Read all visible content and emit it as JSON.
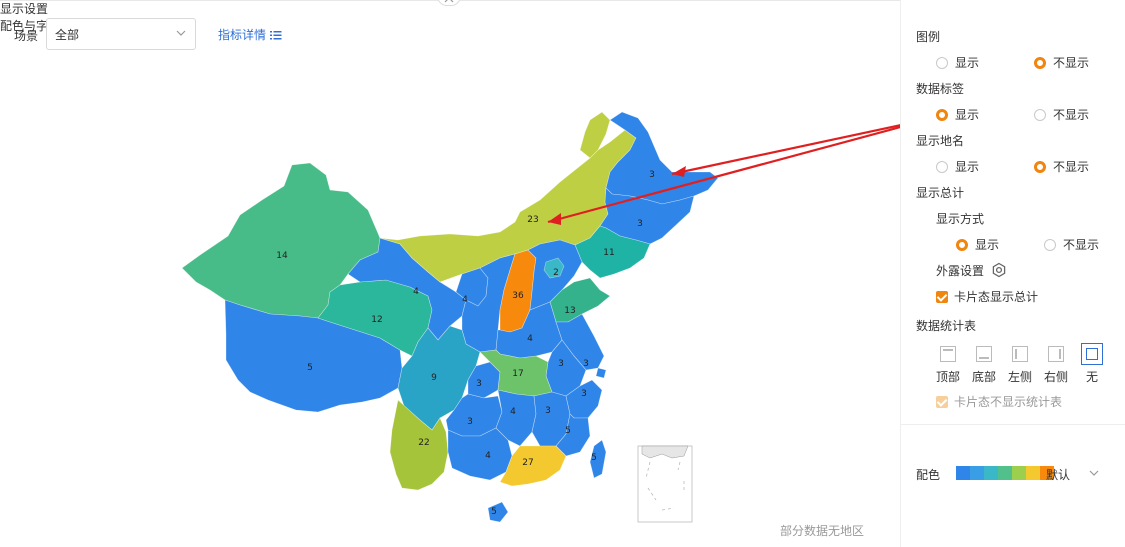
{
  "toolbar": {
    "scene_label": "场景",
    "scene_value": "全部",
    "detail_link": "指标详情"
  },
  "map": {
    "no_data_note": "部分数据无地区",
    "region_values": [
      "14",
      "12",
      "5",
      "9",
      "22",
      "3",
      "4",
      "27",
      "5",
      "17",
      "4",
      "3",
      "5",
      "3",
      "3",
      "3",
      "3",
      "4",
      "36",
      "4",
      "4",
      "2",
      "13",
      "11",
      "3",
      "3",
      "23",
      "5"
    ]
  },
  "panel": {
    "display_settings": "显示设置",
    "legend_label": "图例",
    "data_label_label": "数据标签",
    "place_name_label": "显示地名",
    "show_total_label": "显示总计",
    "display_mode_label": "显示方式",
    "show": "显示",
    "hide": "不显示",
    "exposed_settings": "外露设置",
    "card_show_total": "卡片态显示总计",
    "stats_table_label": "数据统计表",
    "positions": [
      "顶部",
      "底部",
      "左侧",
      "右侧",
      "无"
    ],
    "card_hide_stats": "卡片态不显示统计表",
    "color_font": "配色与字体",
    "color_label": "配色",
    "palette_name": "默认",
    "palette_colors": [
      "#2f86e8",
      "#3a9ee6",
      "#3bb8c8",
      "#52c08a",
      "#9ccf4e",
      "#f3c92f",
      "#f78a0c"
    ]
  }
}
